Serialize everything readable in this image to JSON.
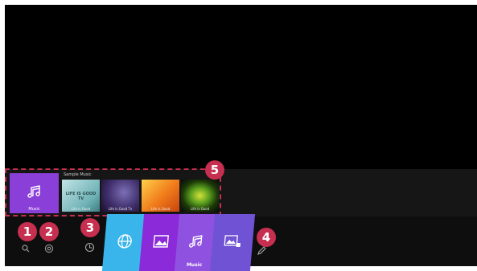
{
  "recent": {
    "source_label": "Sample Music",
    "selected_app_label": "Music",
    "thumbs": [
      {
        "label": "Life is Good",
        "logo": "LIFE IS GOOD TV"
      },
      {
        "label": "Life is Good Tv"
      },
      {
        "label": "Life is Good"
      },
      {
        "label": "Life is Good"
      }
    ]
  },
  "dock": {
    "search_icon": "magnifier-icon",
    "settings_icon": "gear-icon",
    "input_icon": "input-source-icon",
    "apps": [
      {
        "icon": "globe-icon",
        "color": "#3ab5ec"
      },
      {
        "icon": "image-icon",
        "color": "#8b2ad8"
      },
      {
        "icon": "music-note-icon",
        "color": "#8f52e0",
        "label": "Music"
      },
      {
        "icon": "image-plus-icon",
        "color": "#7052d4"
      }
    ],
    "edit_icon": "pencil-icon"
  },
  "callouts": [
    "1",
    "2",
    "3",
    "4",
    "5"
  ],
  "colors": {
    "accent": "#c62f4f",
    "screen": "#000000"
  }
}
